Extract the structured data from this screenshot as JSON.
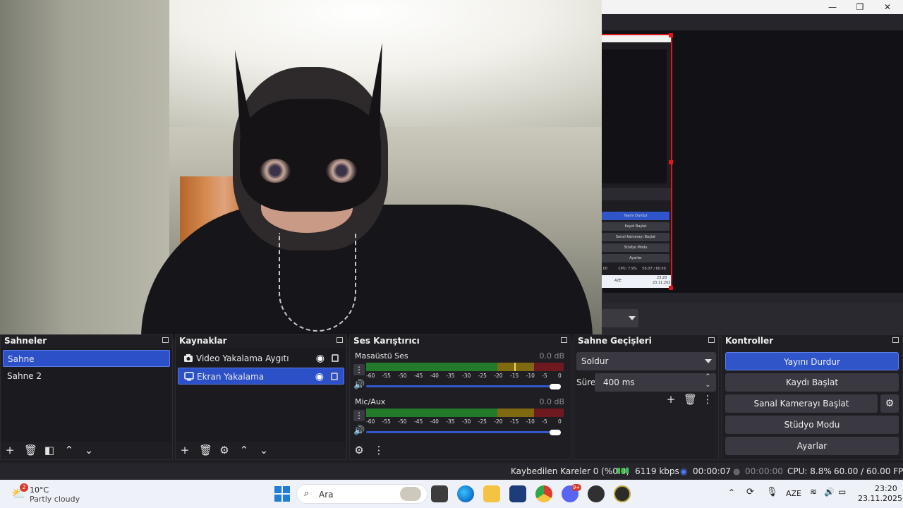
{
  "window": {
    "min_label": "—",
    "max_label": "❐",
    "close_label": "✕"
  },
  "mini_preview": {
    "buttons": [
      "Yayını Durdur",
      "Kaydı Başlat",
      "Sanal Kamerayı Başlat",
      "Stüdyo Modu",
      "Ayarlar"
    ],
    "status": {
      "cpu": "CPU: 7.9%",
      "fps": "56.07 / 60.00 FPS",
      "prefix": ".00"
    },
    "taskbar": {
      "lang": "AZE",
      "time": "23:20",
      "date": "23.11.2025"
    }
  },
  "docks": {
    "scenes": {
      "title": "Sahneler",
      "items": [
        {
          "label": "Sahne",
          "selected": true
        },
        {
          "label": "Sahne 2",
          "selected": false
        }
      ]
    },
    "sources": {
      "title": "Kaynaklar",
      "items": [
        {
          "label": "Video Yakalama Aygıtı",
          "icon": "camera-icon",
          "selected": false
        },
        {
          "label": "Ekran Yakalama",
          "icon": "monitor-icon",
          "selected": true
        }
      ]
    },
    "mixer": {
      "title": "Ses Karıştırıcı",
      "channels": [
        {
          "name": "Masaüstü Ses",
          "db": "0.0 dB",
          "level_db": -15,
          "volume": 1.0
        },
        {
          "name": "Mic/Aux",
          "db": "0.0 dB",
          "level_db": -60,
          "volume": 1.0
        }
      ],
      "ticks": [
        "-60",
        "-55",
        "-50",
        "-45",
        "-40",
        "-35",
        "-30",
        "-25",
        "-20",
        "-15",
        "-10",
        "-5",
        "0"
      ]
    },
    "transitions": {
      "title": "Sahne Geçişleri",
      "selected": "Soldur",
      "duration_label": "Süre",
      "duration_value": "400 ms"
    },
    "controls": {
      "title": "Kontroller",
      "buttons": [
        "Yayını Durdur",
        "Kaydı Başlat",
        "Sanal Kamerayı Başlat",
        "Stüdyo Modu",
        "Ayarlar"
      ]
    }
  },
  "statusbar": {
    "dropped": "Kaybedilen Kareler 0 (%0.0)",
    "bitrate": "6119 kbps",
    "stream_time": "00:00:07",
    "record_time": "00:00:00",
    "cpu": "CPU: 8.8%",
    "fps": "60.00 / 60.00 FPS"
  },
  "taskbar": {
    "weather_temp": "10°C",
    "weather_desc": "Partly cloudy",
    "weather_badge": "2",
    "search_placeholder": "Ara",
    "lang": "AZE",
    "time": "23:20",
    "date": "23.11.2025",
    "discord_badge": "9+"
  },
  "colors": {
    "accent": "#2f55c9",
    "panel": "#1f1e23",
    "meter_green": "#227a2a",
    "meter_yellow": "#7f6a12",
    "meter_red": "#6e1820"
  }
}
